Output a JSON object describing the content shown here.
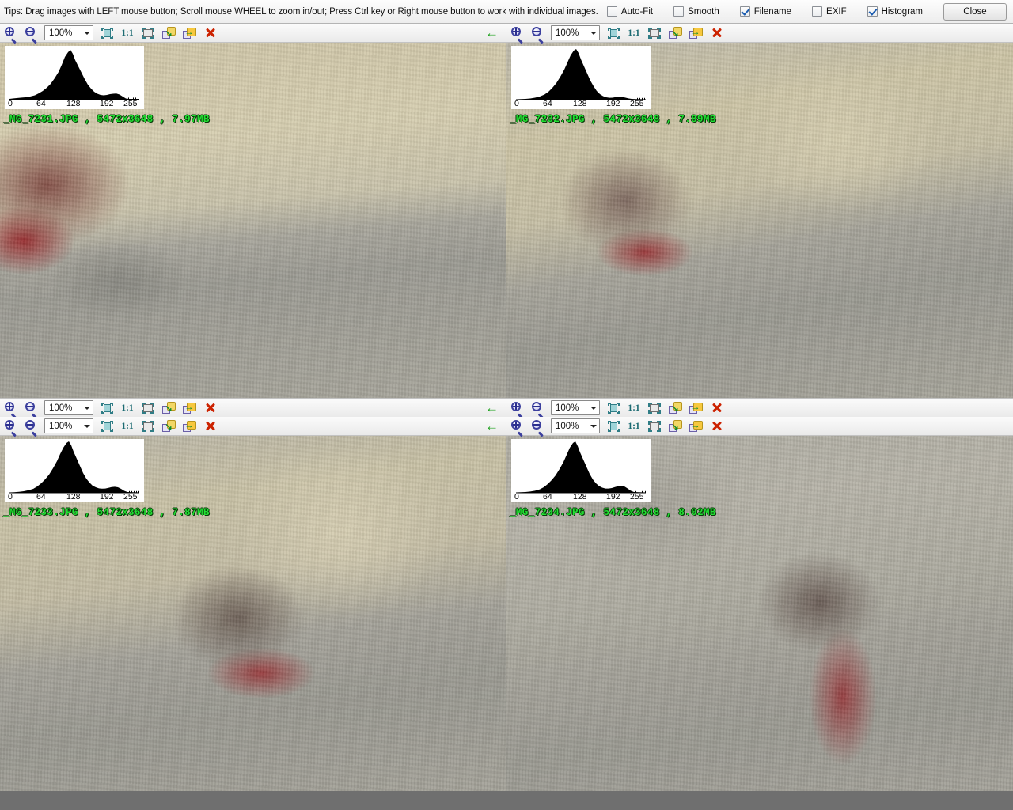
{
  "tipbar": {
    "tip_text": "Tips: Drag images with LEFT mouse button; Scroll mouse WHEEL to zoom in/out; Press Ctrl key or Right mouse button to work with individual images.",
    "options": [
      {
        "label": "Auto-Fit",
        "checked": false,
        "name": "auto-fit"
      },
      {
        "label": "Smooth",
        "checked": false,
        "name": "smooth"
      },
      {
        "label": "Filename",
        "checked": true,
        "name": "filename"
      },
      {
        "label": "EXIF",
        "checked": false,
        "name": "exif"
      },
      {
        "label": "Histogram",
        "checked": true,
        "name": "histogram"
      }
    ],
    "close_label": "Close"
  },
  "toolbar": {
    "zoom_in_icon": "zoom-in-icon",
    "zoom_out_icon": "zoom-out-icon",
    "zoom_value": "100%",
    "fit_icon": "fit-to-window-icon",
    "one_to_one_label": "1:1",
    "actual_size_icon": "full-screen-icon",
    "apply_to_all_icon": "apply-to-all-icon",
    "copy_settings_icon": "copy-settings-icon",
    "close_image_icon": "close-image-icon",
    "back_arrow_icon": "back-arrow-icon"
  },
  "histogram": {
    "ticks": [
      "0",
      "64",
      "128",
      "192",
      "255"
    ],
    "tick_positions": [
      0,
      64,
      128,
      192,
      255
    ],
    "axis_min": 0,
    "axis_max": 255
  },
  "panels": [
    {
      "name": "panel-top-left",
      "filename": "_MG_7231.JPG",
      "dimensions": "5472x3648",
      "filesize": "7.97MB",
      "overlay_text": "_MG_7231.JPG , 5472x3648 , 7.97MB",
      "zoom_value": "100%",
      "has_back_arrow": true
    },
    {
      "name": "panel-top-right",
      "filename": "_MG_7232.JPG",
      "dimensions": "5472x3648",
      "filesize": "7.89MB",
      "overlay_text": "_MG_7232.JPG , 5472x3648 , 7.89MB",
      "zoom_value": "100%",
      "has_back_arrow": false
    },
    {
      "name": "panel-bottom-left",
      "filename": "_MG_7233.JPG",
      "dimensions": "5472x3648",
      "filesize": "7.87MB",
      "overlay_text": "_MG_7233.JPG , 5472x3648 , 7.87MB",
      "zoom_value": "100%",
      "has_back_arrow": true
    },
    {
      "name": "panel-bottom-right",
      "filename": "_MG_7234.JPG",
      "dimensions": "5472x3648",
      "filesize": "8.02MB",
      "overlay_text": "_MG_7234.JPG , 5472x3648 , 8.02MB",
      "zoom_value": "100%",
      "has_back_arrow": false
    }
  ],
  "chart_data": [
    {
      "type": "bar",
      "title": "_MG_7231.JPG luminance histogram",
      "xlabel": "",
      "ylabel": "",
      "xlim": [
        0,
        255
      ],
      "ylim": [
        0,
        100
      ],
      "tick_labels": [
        "0",
        "64",
        "128",
        "192",
        "255"
      ],
      "x": [
        0,
        8,
        16,
        24,
        32,
        40,
        48,
        56,
        64,
        72,
        80,
        88,
        96,
        104,
        112,
        120,
        128,
        136,
        144,
        152,
        160,
        168,
        176,
        184,
        192,
        200,
        208,
        216,
        224,
        232,
        240,
        248,
        255
      ],
      "values": [
        2,
        2,
        3,
        3,
        4,
        6,
        9,
        14,
        20,
        27,
        36,
        52,
        74,
        95,
        100,
        86,
        66,
        48,
        34,
        25,
        19,
        15,
        13,
        14,
        16,
        13,
        5,
        3,
        2,
        2,
        2,
        2,
        2
      ]
    },
    {
      "type": "bar",
      "title": "_MG_7232.JPG luminance histogram",
      "xlabel": "",
      "ylabel": "",
      "xlim": [
        0,
        255
      ],
      "ylim": [
        0,
        100
      ],
      "tick_labels": [
        "0",
        "64",
        "128",
        "192",
        "255"
      ],
      "x": [
        0,
        8,
        16,
        24,
        32,
        40,
        48,
        56,
        64,
        72,
        80,
        88,
        96,
        104,
        112,
        120,
        128,
        136,
        144,
        152,
        160,
        168,
        176,
        184,
        192,
        200,
        208,
        216,
        224,
        232,
        240,
        248,
        255
      ],
      "values": [
        1,
        1,
        2,
        3,
        4,
        6,
        10,
        16,
        24,
        34,
        48,
        66,
        86,
        98,
        100,
        84,
        60,
        40,
        26,
        17,
        12,
        10,
        10,
        11,
        9,
        5,
        3,
        2,
        1,
        1,
        1,
        1,
        1
      ]
    },
    {
      "type": "bar",
      "title": "_MG_7233.JPG luminance histogram",
      "xlabel": "",
      "ylabel": "",
      "xlim": [
        0,
        255
      ],
      "ylim": [
        0,
        100
      ],
      "tick_labels": [
        "0",
        "64",
        "128",
        "192",
        "255"
      ],
      "x": [
        0,
        8,
        16,
        24,
        32,
        40,
        48,
        56,
        64,
        72,
        80,
        88,
        96,
        104,
        112,
        120,
        128,
        136,
        144,
        152,
        160,
        168,
        176,
        184,
        192,
        200,
        208,
        216,
        224,
        232,
        240,
        248,
        255
      ],
      "values": [
        1,
        2,
        2,
        3,
        5,
        8,
        12,
        18,
        26,
        36,
        50,
        70,
        90,
        100,
        96,
        80,
        58,
        40,
        28,
        20,
        16,
        15,
        16,
        18,
        14,
        6,
        3,
        2,
        1,
        1,
        1,
        1,
        1
      ]
    },
    {
      "type": "bar",
      "title": "_MG_7234.JPG luminance histogram",
      "xlabel": "",
      "ylabel": "",
      "xlim": [
        0,
        255
      ],
      "ylim": [
        0,
        100
      ],
      "tick_labels": [
        "0",
        "64",
        "128",
        "192",
        "255"
      ],
      "x": [
        0,
        8,
        16,
        24,
        32,
        40,
        48,
        56,
        64,
        72,
        80,
        88,
        96,
        104,
        112,
        120,
        128,
        136,
        144,
        152,
        160,
        168,
        176,
        184,
        192,
        200,
        208,
        216,
        224,
        232,
        240,
        248,
        255
      ],
      "values": [
        1,
        1,
        2,
        3,
        4,
        7,
        11,
        17,
        25,
        35,
        50,
        72,
        92,
        100,
        94,
        76,
        54,
        36,
        25,
        19,
        17,
        18,
        20,
        21,
        15,
        6,
        3,
        2,
        1,
        1,
        1,
        1,
        1
      ]
    }
  ],
  "colors": {
    "overlay_text": "#22e033",
    "histogram_fill": "#000000",
    "histogram_bg": "#ffffff",
    "toolbar_bg": "#f0f0f0",
    "accent_blue": "#1b5cb0"
  }
}
